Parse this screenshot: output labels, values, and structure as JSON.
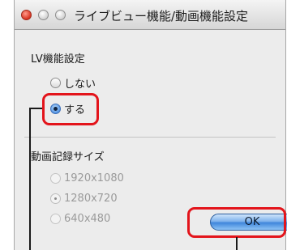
{
  "window": {
    "title": "ライブビュー機能/動画機能設定"
  },
  "lv_settings": {
    "label": "LV機能設定",
    "options": [
      {
        "label": "しない",
        "selected": false,
        "enabled": true
      },
      {
        "label": "する",
        "selected": true,
        "enabled": true
      }
    ]
  },
  "movie_size": {
    "label": "動画記録サイズ",
    "options": [
      {
        "label": "1920x1080",
        "selected": false,
        "enabled": false
      },
      {
        "label": "1280x720",
        "selected": true,
        "enabled": false
      },
      {
        "label": "640x480",
        "selected": false,
        "enabled": false
      }
    ]
  },
  "buttons": {
    "ok_label": "OK"
  },
  "colors": {
    "callout": "#e3141b",
    "accent": "#3f86dc"
  }
}
